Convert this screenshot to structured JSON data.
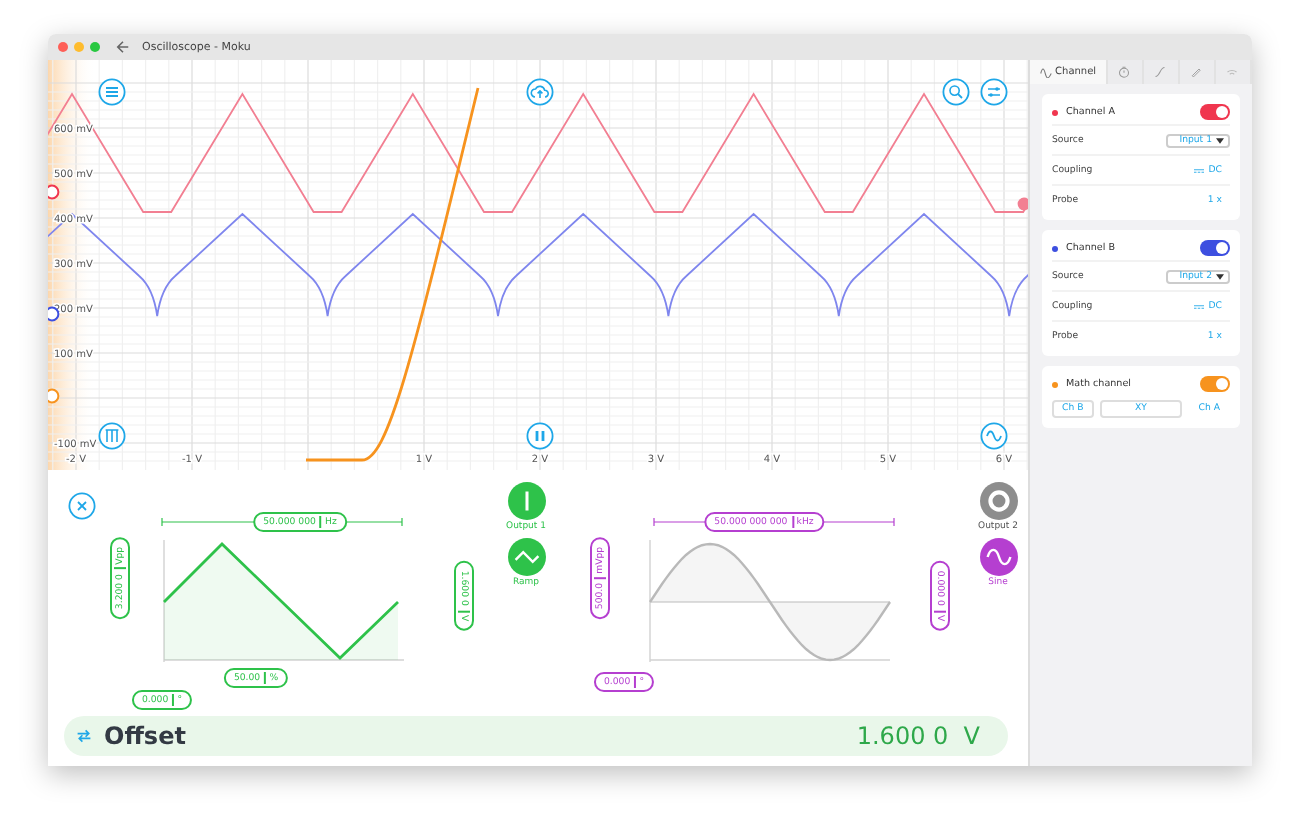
{
  "window": {
    "title": "Oscilloscope - Moku"
  },
  "plot": {
    "y_tick_labels": [
      "600 mV",
      "500 mV",
      "400 mV",
      "300 mV",
      "200 mV",
      "100 mV",
      "-100 mV"
    ],
    "x_tick_labels": [
      "-2 V",
      "-1 V",
      "1 V",
      "2 V",
      "3 V",
      "4 V",
      "5 V",
      "6 V"
    ]
  },
  "sidebar": {
    "tabs": [
      {
        "label": "Channel",
        "selected": true
      },
      {
        "selected": false
      },
      {
        "selected": false
      },
      {
        "selected": false
      },
      {
        "selected": false
      }
    ],
    "cards": [
      {
        "kind": "channel",
        "name": "Channel A",
        "color": "#f0364f",
        "on": true,
        "source_label": "Source",
        "source": "Input 1",
        "coupling_label": "Coupling",
        "coupling": "DC",
        "probe_label": "Probe",
        "probe": "1 x"
      },
      {
        "kind": "channel",
        "name": "Channel B",
        "color": "#3d4fe0",
        "on": true,
        "source_label": "Source",
        "source": "Input 2",
        "coupling_label": "Coupling",
        "coupling": "DC",
        "probe_label": "Probe",
        "probe": "1 x"
      },
      {
        "kind": "math",
        "name": "Math channel",
        "color": "#f7931e",
        "on": true,
        "buttons": [
          "Ch B",
          "XY",
          "Ch A"
        ]
      }
    ]
  },
  "generators": [
    {
      "kind": "ramp",
      "output": "Output 1",
      "waveform": "Ramp",
      "on": true,
      "color": "#2ec24a",
      "frequency": {
        "value": "50.000 000",
        "unit": "Hz"
      },
      "amplitude": {
        "value": "3.200 0",
        "unit": "Vpp"
      },
      "offset": {
        "value": "1.600 0",
        "unit": "V"
      },
      "symmetry": {
        "value": "50.00",
        "unit": "%"
      },
      "phase": {
        "value": "0.000",
        "unit": "°"
      }
    },
    {
      "kind": "sine",
      "output": "Output 2",
      "waveform": "Sine",
      "on": false,
      "color": "#b53fd0",
      "frequency": {
        "value": "50.000 000 000",
        "unit": "kHz"
      },
      "amplitude": {
        "value": "500.0",
        "unit": "mVpp"
      },
      "offset": {
        "value": "0.000 0",
        "unit": "V"
      },
      "phase": {
        "value": "0.000",
        "unit": "°"
      }
    }
  ],
  "offset_bar": {
    "label": "Offset",
    "value": "1.600 0",
    "unit": "V"
  }
}
